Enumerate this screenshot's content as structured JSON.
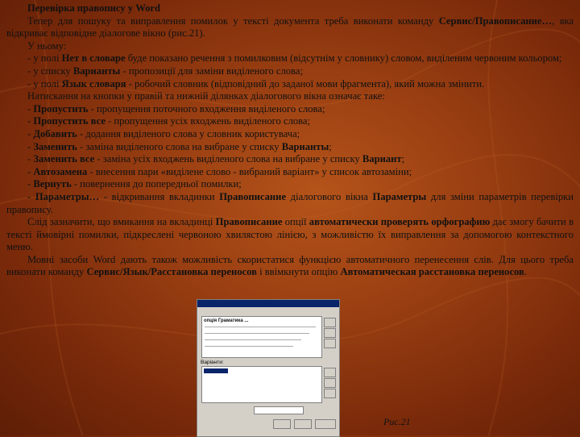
{
  "doc": {
    "title": "Перевірка правопису у Word",
    "p1_a": "Тепер для пошуку та виправлення помилок у тексті документа треба виконати команду ",
    "p1_b": "Сервис/Правописание…",
    "p1_c": ", яка відкриває відповідне діалогове вікно (рис.21).",
    "p2": "У ньому:",
    "l1_a": "- у полі ",
    "l1_b": "Нет в словаре",
    "l1_c": " буде показано речення з помилковим (відсутнім у словнику) словом, виділеним червоним кольором;",
    "l2_a": "- у списку ",
    "l2_b": "Варианты",
    "l2_c": " - пропозиції для заміни виділеного слова;",
    "l3_a": "- у полі ",
    "l3_b": "Язык словаря",
    "l3_c": " - робочий словник (відповідний до заданої мови фрагмента), який можна змінити.",
    "p3": "Натискання на кнопки у правій та нижній ділянках діалогового вікна означає таке:",
    "b1_a": "- ",
    "b1_b": "Пропустить",
    "b1_c": " - пропущення поточного входження виділеного слова;",
    "b2_a": "- ",
    "b2_b": "Пропустить все",
    "b2_c": " - пропущення усіх входжень виділеного слова;",
    "b3_a": "- ",
    "b3_b": "Добавить",
    "b3_c": " - додання виділеного слова у словник користувача;",
    "b4_a": "- ",
    "b4_b": "Заменить",
    "b4_c": " - заміна виділеного слова на вибране у списку ",
    "b4_d": "Варианты",
    "b4_e": ";",
    "b5_a": "- ",
    "b5_b": "Заменить все",
    "b5_c": " - заміна усіх входжень виділеного слова на вибране у списку ",
    "b5_d": "Вариант",
    "b5_e": ";",
    "b6_a": "- ",
    "b6_b": "Автозамена",
    "b6_c": " - внесення пари «виділене слово - вибраний варіант» у список автозаміни;",
    "b7_a": "- ",
    "b7_b": "Вернуть",
    "b7_c": " - повернення до попередньої помилки;",
    "b8_a": "- ",
    "b8_b": "Параметры…",
    "b8_c": " - відкривання вкладинки ",
    "b8_d": "Правописание",
    "b8_e": " діалогового вікна ",
    "b8_f": "Параметры",
    "b8_g": " для зміни параметрів перевірки правопису.",
    "p4_a": "Слід зазначити, що вмикання на вкладинці ",
    "p4_b": "Правописание",
    "p4_c": " опції ",
    "p4_d": "автоматически проверять орфографию",
    "p4_e": " дає змогу бачити в тексті ймовірні помилки, підкреслені червоною хвилястою лінією, з можливістю їх виправлення за допомогою контекстного меню.",
    "p5_a": "Мовні засоби Word дають також можливість скористатися функцією автоматичного перенесення слів. Для цього треба виконати команду ",
    "p5_b": "Сервис/Язык/Расстановка переносов",
    "p5_c": " і ввімкнути опцію ",
    "p5_d": "Автоматическая расстановка переносов",
    "p5_e": "."
  },
  "dialog": {
    "field1_text": "опція Граматика ...",
    "label_variants": "Варіанти:"
  },
  "caption": "Рис.21",
  "colors": {
    "bg_center": "#b5541a",
    "bg_edge": "#5e1e06"
  }
}
